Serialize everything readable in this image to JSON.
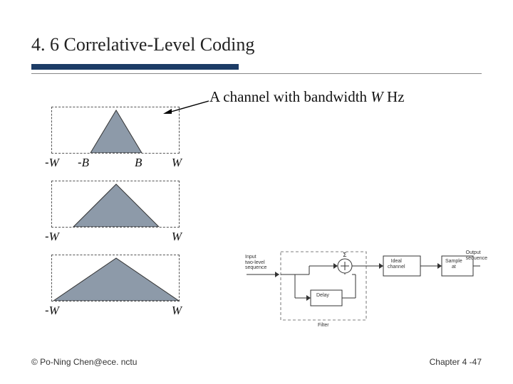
{
  "slide": {
    "title": "4. 6 Correlative-Level Coding",
    "annotation_prefix": "A channel with bandwidth ",
    "annotation_var": "W",
    "annotation_suffix": " Hz",
    "panels": {
      "p1": {
        "left_sign": "-",
        "left_sym": "B",
        "right_sym": "B"
      },
      "p2": {
        "left_sign": "-",
        "left_sym": "W",
        "right_sym": "W"
      },
      "p3": {
        "left_sign": "-",
        "left_sym": "W",
        "right_sym": "W"
      },
      "p4": {
        "left_sign": "-",
        "left_sym": "W",
        "right_sym": "W"
      }
    },
    "diagram": {
      "input_label_1": "Input",
      "input_label_2": "two-level",
      "input_label_3": "sequence",
      "delay_label": "Delay",
      "ideal_label_1": "Ideal",
      "ideal_label_2": "channel",
      "sample_label_1": "Sample",
      "sample_label_2": "at",
      "output_label_1": "Output",
      "output_label_2": "sequence",
      "filter_label": "Filter"
    },
    "footer_left": "© Po-Ning Chen@ece. nctu",
    "footer_right": "Chapter 4 -47"
  },
  "colors": {
    "tri_fill": "#8d9aa9",
    "accent": "#1c3c66"
  }
}
